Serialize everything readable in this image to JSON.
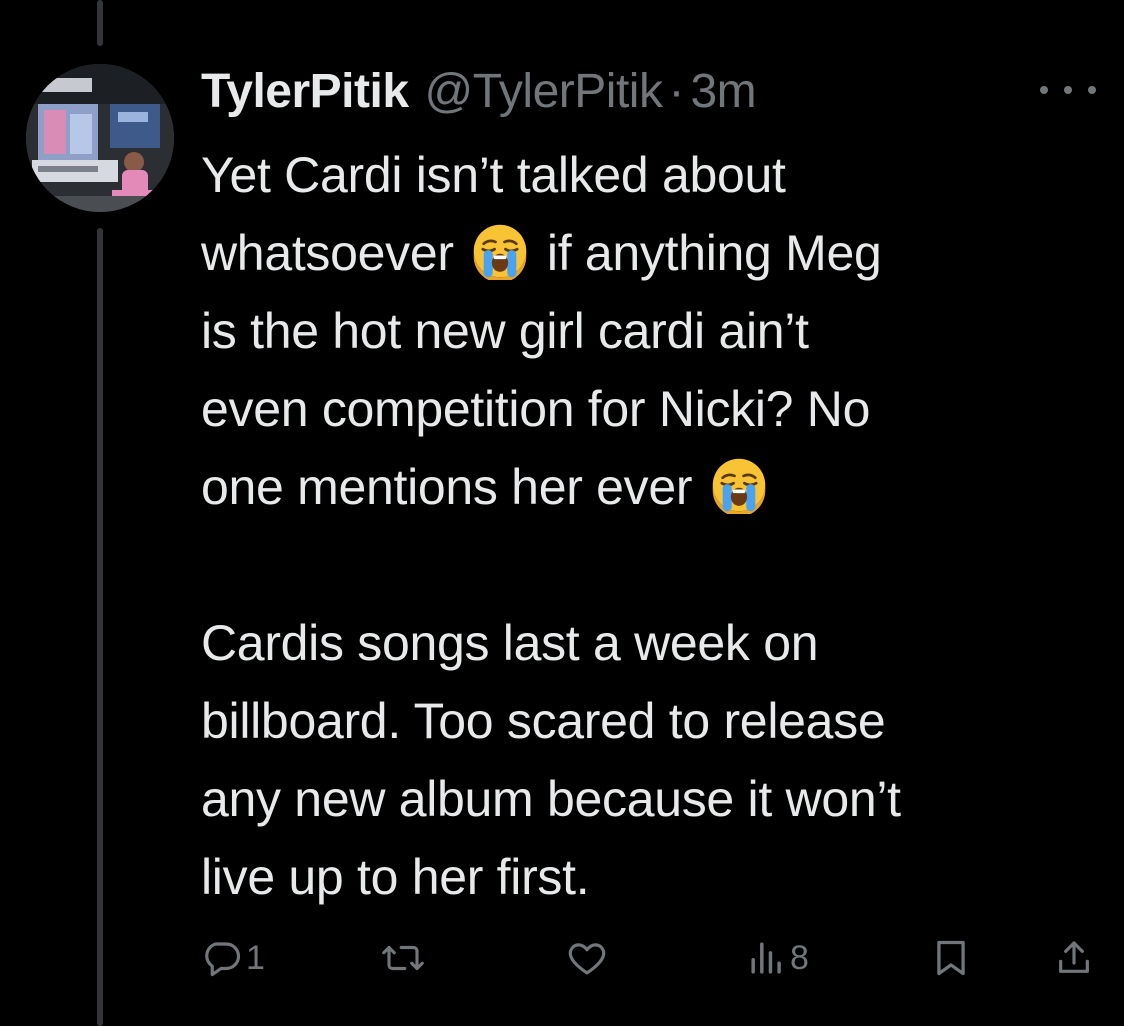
{
  "tweet": {
    "display_name": "TylerPitik",
    "handle": "@TylerPitik",
    "separator": "·",
    "time": "3m",
    "lines_para1": [
      "Yet Cardi isn’t talked about",
      [
        "whatsoever ",
        "crying-face-emoji",
        " if anything Meg"
      ],
      "is the hot new girl cardi ain’t",
      "even competition for Nicki? No",
      [
        "one mentions her ever ",
        "crying-face-emoji",
        ""
      ]
    ],
    "text_l1": "Yet Cardi isn’t talked about",
    "text_l2a": "whatsoever",
    "text_l2b": "if anything Meg",
    "text_l3": "is the hot new girl cardi ain’t",
    "text_l4": "even competition for Nicki? No",
    "text_l5": "one mentions her ever",
    "text_l6": "Cardis songs last a week on",
    "text_l7": "billboard. Too scared to release",
    "text_l8": "any new album because it won’t",
    "text_l9": "live up to her first."
  },
  "actions": {
    "reply_count": "1",
    "retweet_count": "",
    "like_count": "",
    "views_count": "8"
  },
  "icons": {
    "reply": "reply-icon",
    "retweet": "retweet-icon",
    "like": "heart-icon",
    "views": "views-icon",
    "bookmark": "bookmark-icon",
    "share": "share-icon",
    "more": "more-icon",
    "emoji": "crying-face-emoji"
  },
  "colors": {
    "background": "#000000",
    "text": "#e7e9ea",
    "secondary": "#71767b",
    "thread_line": "#333639"
  }
}
